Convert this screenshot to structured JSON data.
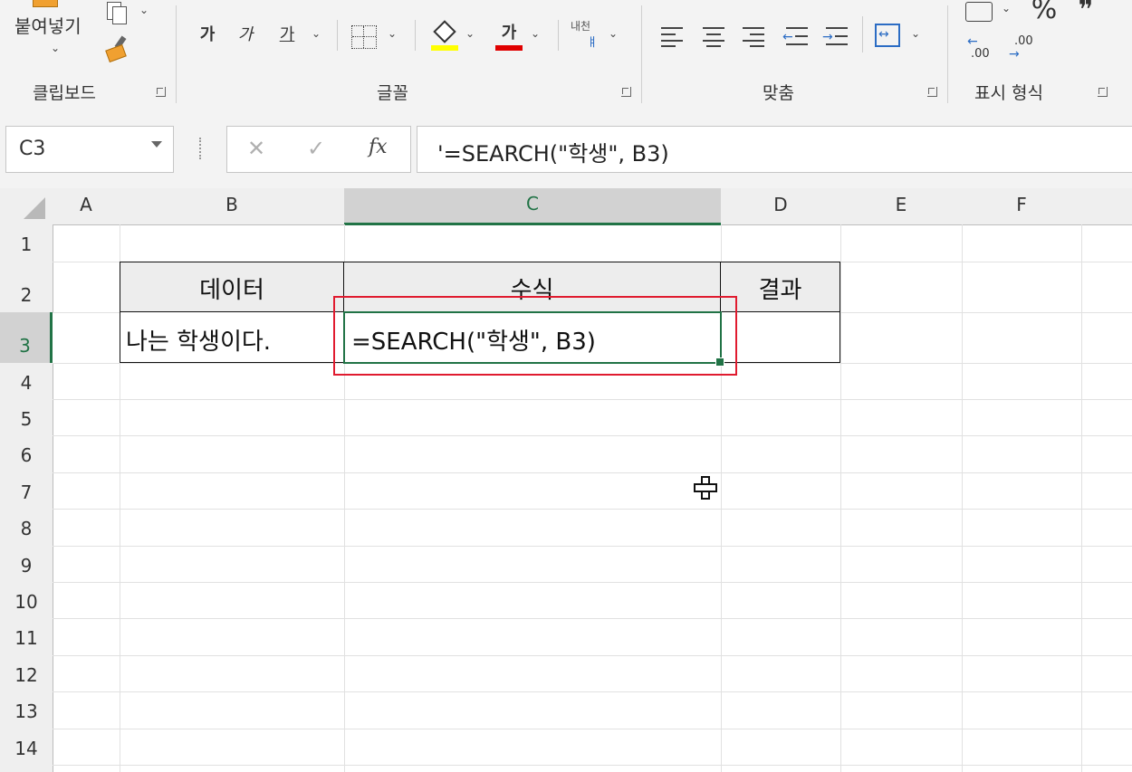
{
  "ribbon": {
    "clipboard": {
      "label": "클립보드",
      "paste_label": "붙여넣기"
    },
    "font": {
      "label": "글꼴",
      "bold": "가",
      "italic": "가",
      "underline": "가",
      "font_color": "가",
      "phonetic_top": "내천",
      "phonetic_bottom": "ㅒ"
    },
    "alignment": {
      "label": "맞춤"
    },
    "number": {
      "label": "표시 형식",
      "percent": "%",
      "comma": "❞",
      "inc_decimal": ".00",
      "dec_decimal": ".00"
    },
    "colors": {
      "fill": "#ffff00",
      "font_color": "#e00000",
      "accent": "#217346",
      "highlight_box": "#e01b2f"
    }
  },
  "formula_bar": {
    "name_box": "C3",
    "cancel": "✕",
    "enter": "✓",
    "fx": "fx",
    "formula": "'=SEARCH(\"학생\", B3)"
  },
  "sheet": {
    "columns": [
      "A",
      "B",
      "C",
      "D",
      "E",
      "F"
    ],
    "rows": [
      "1",
      "2",
      "3",
      "4",
      "5",
      "6",
      "7",
      "8",
      "9",
      "10",
      "11",
      "12",
      "13",
      "14"
    ],
    "selected_cell": "C3",
    "cells": {
      "B2": "데이터",
      "C2": "수식",
      "D2": "결과",
      "B3": "나는 학생이다.",
      "C3": "=SEARCH(\"학생\", B3)",
      "D3": ""
    }
  }
}
